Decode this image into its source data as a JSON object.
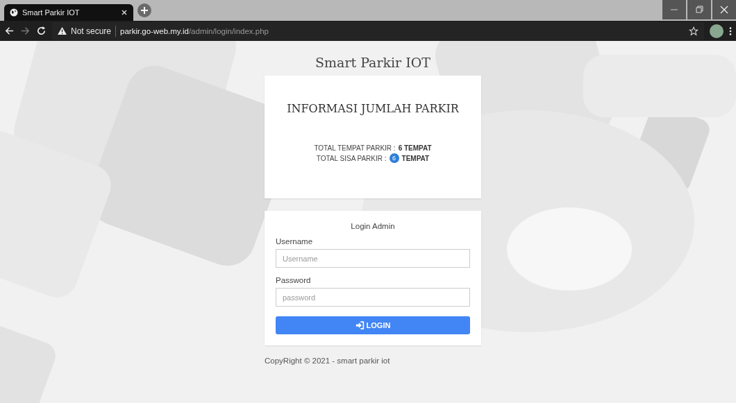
{
  "browser": {
    "tab": {
      "title": "Smart Parkir IOT",
      "selected": true
    },
    "security": "Not secure",
    "url": {
      "host": "parkir.go-web.my.id",
      "path": "/admin/login/index.php"
    }
  },
  "page": {
    "title": "Smart Parkir IOT",
    "info": {
      "heading": "INFORMASI JUMLAH PARKIR",
      "lines": [
        {
          "label": "TOTAL TEMPAT PARKIR :",
          "count": "6",
          "unit": "TEMPAT",
          "kind": "plain"
        },
        {
          "label": "TOTAL SISA PARKIR :",
          "count": "6",
          "unit": "TEMPAT",
          "kind": "badge",
          "color": "#2f7fd8"
        }
      ]
    },
    "login": {
      "heading": "Login Admin",
      "fields": [
        {
          "label": "Username",
          "placeholder": "Username"
        },
        {
          "label": "Password",
          "placeholder": "password"
        }
      ],
      "button": "LOGIN"
    },
    "footer": "CopyRight © 2021 - smart parkir iot"
  }
}
